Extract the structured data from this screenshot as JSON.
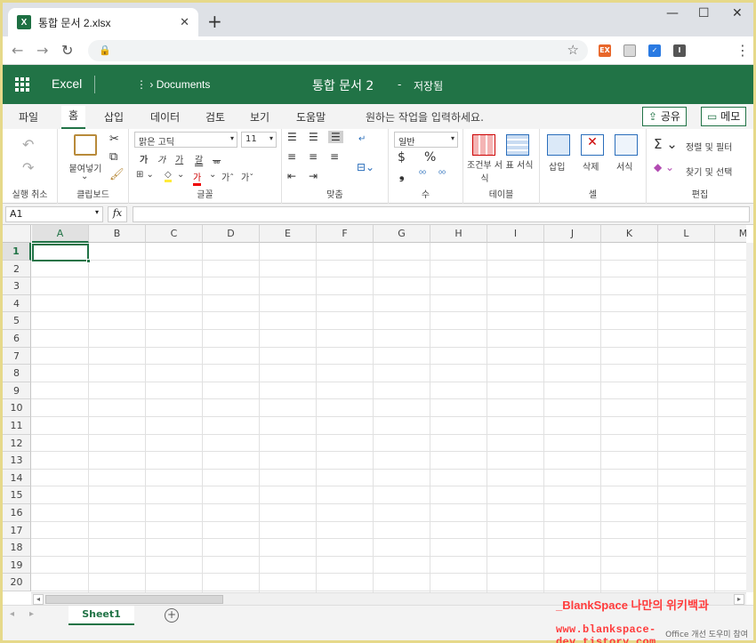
{
  "browser": {
    "tab_title": "통합 문서 2.xlsx",
    "tab_icon": "X",
    "new_tab": "+",
    "extensions": [
      {
        "label": "EX",
        "color": "#e8672b"
      },
      {
        "label": "",
        "color": "#d9d9d9"
      },
      {
        "label": "",
        "color": "#2a7ae2"
      },
      {
        "label": "I",
        "color": "#555555"
      }
    ]
  },
  "excel": {
    "app_name": "Excel",
    "breadcrumb": "Documents",
    "breadcrumb_prefix": "⋮ ›",
    "doc_title": "통합 문서 2",
    "title_sep": "-",
    "save_status": "저장됨",
    "brand_color": "#217346"
  },
  "menu": {
    "tabs": [
      "파일",
      "홈",
      "삽입",
      "데이터",
      "검토",
      "보기",
      "도움말"
    ],
    "active_tab": "홈",
    "tell_me": "원하는 작업을 입력하세요.",
    "share": "공유",
    "comments": "메모"
  },
  "ribbon": {
    "undo_group": "실행 취소",
    "clipboard": {
      "paste": "붙여넣기",
      "label": "클립보드"
    },
    "font": {
      "name": "맑은 고딕",
      "size": "11",
      "label": "글꼴",
      "btn_bold": "가",
      "btn_italic": "가",
      "btn_underline": "가",
      "btn_strike": "갈",
      "btn_sub": "ᅟ가",
      "grow": "가ˆ",
      "shrink": "가ˇ"
    },
    "align": {
      "label": "맞춤"
    },
    "number": {
      "format": "일반",
      "label": "수",
      "currency": "$",
      "percent": "%",
      "comma": "❟"
    },
    "tables": {
      "cond": "조건부 서식",
      "table": "표 서식",
      "label": "테이블"
    },
    "cells": {
      "insert": "삽입",
      "delete": "삭제",
      "format": "서식",
      "label": "셀"
    },
    "editing": {
      "sort": "정렬 및 필터",
      "find": "찾기 및 선택",
      "label": "편집"
    }
  },
  "formula_bar": {
    "name_box": "A1",
    "fx": "fx",
    "value": ""
  },
  "grid": {
    "columns": [
      "A",
      "B",
      "C",
      "D",
      "E",
      "F",
      "G",
      "H",
      "I",
      "J",
      "K",
      "L",
      "M"
    ],
    "rows": [
      "1",
      "2",
      "3",
      "4",
      "5",
      "6",
      "7",
      "8",
      "9",
      "10",
      "11",
      "12",
      "13",
      "14",
      "15",
      "16",
      "17",
      "18",
      "19",
      "20"
    ],
    "active_cell": "A1"
  },
  "sheets": {
    "tabs": [
      "Sheet1"
    ],
    "active": "Sheet1",
    "add": "+"
  },
  "status": {
    "text": "Office 개선 도우미 참여"
  },
  "watermark": {
    "line1": "_BlankSpace 나만의 위키백과",
    "line2": "www.blankspace-dev.tistory.com"
  }
}
